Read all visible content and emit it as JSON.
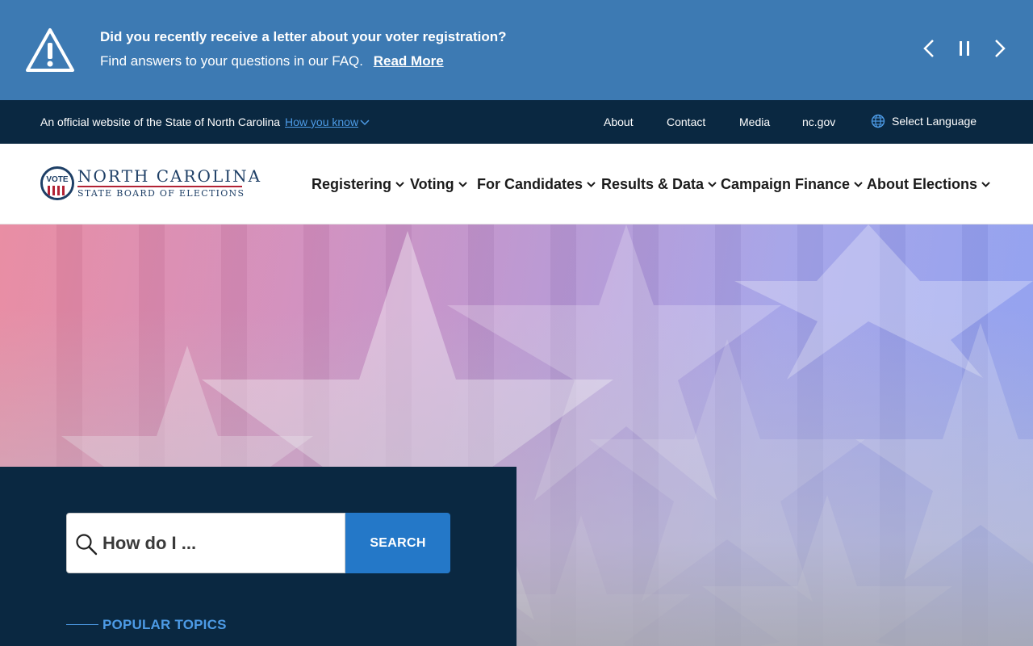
{
  "alert": {
    "title": "Did you recently receive a letter about your voter registration?",
    "body": "Find answers to your questions in our FAQ.",
    "link": "Read More",
    "icon": "warning-icon",
    "controls": [
      "chevron-left-icon",
      "pause-icon",
      "chevron-right-icon"
    ]
  },
  "utility": {
    "official_text": "An official website of the State of North Carolina",
    "how_you_know": "How you know",
    "links": [
      "About",
      "Contact",
      "Media",
      "nc.gov"
    ],
    "language": "Select Language"
  },
  "header": {
    "logo": {
      "seal_text": "VOTE",
      "name": "NORTH CAROLINA",
      "subname": "STATE BOARD OF ELECTIONS"
    },
    "nav": [
      "Registering",
      "Voting",
      "For Candidates",
      "Results & Data",
      "Campaign Finance",
      "About Elections"
    ]
  },
  "search": {
    "placeholder": "How do I ...",
    "button": "SEARCH"
  },
  "popular_topics": "POPULAR TOPICS",
  "colors": {
    "alert_bg": "#3d7ab3",
    "navy": "#0a2841",
    "accent_blue": "#2478c8",
    "link_blue": "#4d9be6",
    "brand_red": "#b22234"
  }
}
